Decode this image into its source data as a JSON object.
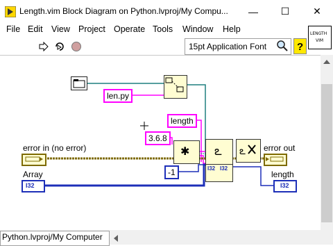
{
  "window": {
    "title": "Length.vim Block Diagram on Python.lvproj/My Compu...",
    "icon": "labview-vi-icon",
    "minimize_glyph": "—",
    "maximize_glyph": "☐",
    "close_glyph": "✕"
  },
  "menu": {
    "items": [
      "File",
      "Edit",
      "View",
      "Project",
      "Operate",
      "Tools",
      "Window",
      "Help"
    ]
  },
  "toolbar": {
    "run_icon": "run-arrow-icon",
    "continuous_icon": "run-continuously-icon",
    "abort_icon": "abort-icon",
    "font_label": "15pt Application Font",
    "vi_icon_text_1": "LENGTH",
    "vi_icon_text_2": "VIM"
  },
  "diagram": {
    "path_constant": "len.py",
    "string_constant_length": "length",
    "version_constant": "3.6.8",
    "numeric_constant": "-1",
    "error_in_label": "error in (no error)",
    "error_out_label": "error out",
    "array_label": "Array",
    "length_label": "length",
    "i32_array": "I32",
    "i32_length": "I32",
    "i32_tag_a": "I32",
    "i32_tag_b": "I32",
    "colors": {
      "pink_wire": "#ff00ff",
      "blue_wire": "#1d2fb8",
      "teal_wire": "#1f7f7f",
      "error_wire": "#7d6a00"
    }
  },
  "status": {
    "context": "Python.lvproj/My Computer"
  }
}
